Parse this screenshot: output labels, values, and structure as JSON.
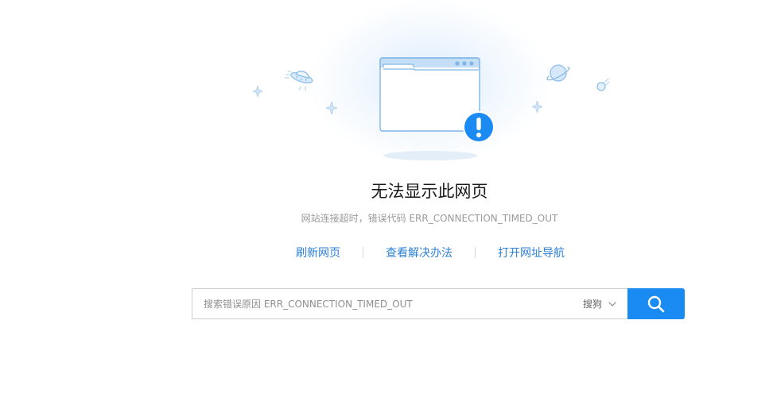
{
  "error": {
    "title": "无法显示此网页",
    "subtitle": "网站连接超时，错误代码 ERR_CONNECTION_TIMED_OUT"
  },
  "actions": {
    "refresh_label": "刷新网页",
    "solutions_label": "查看解决办法",
    "navigation_label": "打开网址导航"
  },
  "search": {
    "placeholder": "搜索错误原因 ERR_CONNECTION_TIMED_OUT",
    "value": "",
    "engine": "搜狗",
    "button_icon": "search-icon"
  },
  "icons": {
    "illustration": "browser-window-icon",
    "alert": "exclamation-icon",
    "ufo": "ufo-icon",
    "planet": "planet-icon",
    "comet": "comet-icon",
    "sparkle": "sparkle-icon"
  },
  "colors": {
    "accent": "#1a8bf3",
    "link": "#2c81d6",
    "title": "#1a1a1a",
    "subtitle": "#9a9a9a"
  }
}
